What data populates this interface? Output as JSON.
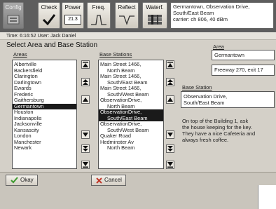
{
  "toolbar": {
    "config": "Config",
    "check": "Check",
    "power": "Power",
    "power_value": "21.3",
    "freq": "Freq.",
    "reflect": "Reflect",
    "waterfall": "Waterf."
  },
  "status": {
    "line1": "Germantown, Observation Drive,",
    "line2": "South/East Beam",
    "line3": "carrier: ch 806, 40 dBm"
  },
  "info_line": "Time: 6:16:52 User: Jack Daniel",
  "section_title": "Select Area and Base Station",
  "areas": {
    "heading": "Areas",
    "items": [
      "Albertville",
      "Backersfield",
      "Clarington",
      "Darlingtown",
      "Ewards",
      "Frederic",
      "Gaithersburg",
      "Germantown",
      "Houston",
      "Indianapolis",
      "Jacksonville",
      "Kansascity",
      "London",
      "Manchester",
      "Newark"
    ],
    "selected": "Germantown"
  },
  "stations": {
    "heading": "Base Stations",
    "items": [
      {
        "text": "Main Street 1466,",
        "sub": false
      },
      {
        "text": "North Beam",
        "sub": true
      },
      {
        "text": "Main Street 1466,",
        "sub": false
      },
      {
        "text": "South/East Beam",
        "sub": true
      },
      {
        "text": "Main Street 1466,",
        "sub": false
      },
      {
        "text": "South/West Beam",
        "sub": true
      },
      {
        "text": "ObservationDrive,",
        "sub": false
      },
      {
        "text": "North Beam",
        "sub": true
      },
      {
        "text": "ObservationDrive,",
        "sub": false
      },
      {
        "text": "South/East Beam",
        "sub": true
      },
      {
        "text": "ObservationDrive,",
        "sub": false
      },
      {
        "text": "South/West Beam",
        "sub": true
      },
      {
        "text": "Quaker Road",
        "sub": false
      },
      {
        "text": "Hedminster Av",
        "sub": false
      },
      {
        "text": "North Beam",
        "sub": true
      }
    ],
    "selected_rows": [
      8,
      9
    ]
  },
  "area_panel": {
    "heading": "Area",
    "name": "Germantown",
    "location": "Freeway 270, exit 17"
  },
  "station_panel": {
    "heading": "Base Station",
    "line1": "Observation Drive,",
    "line2": "South/East Beam",
    "notes": [
      "On top of the Building 1, ask",
      "the house keeping for the key.",
      "They have a nice Cafeteria and",
      "always fresh coffee."
    ]
  },
  "buttons": {
    "ok": "Okay",
    "cancel": "Cancel"
  },
  "colors": {
    "ok_check": "#3c9a2e",
    "cancel_x": "#c0392b",
    "selection": "#1a1a1a"
  }
}
